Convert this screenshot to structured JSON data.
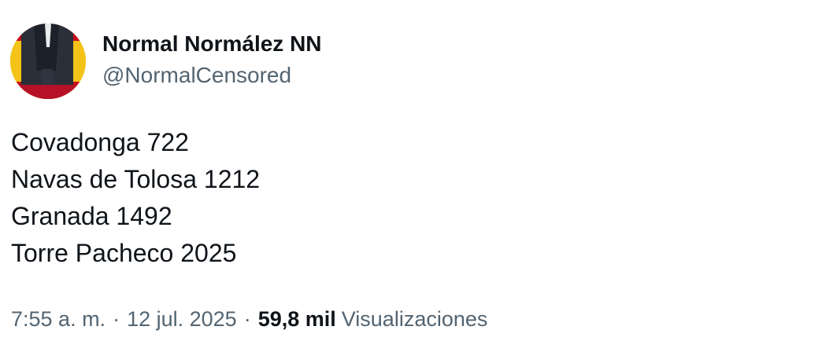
{
  "author": {
    "display_name": "Normal Normález NN",
    "handle": "@NormalCensored",
    "avatar_icon": "profile-avatar-spanish-flag"
  },
  "tweet": {
    "lines": [
      "Covadonga 722",
      "Navas de Tolosa 1212",
      "Granada 1492",
      "Torre Pacheco 2025"
    ]
  },
  "meta": {
    "time": "7:55 a. m.",
    "separator": "·",
    "date": "12 jul. 2025",
    "views_count": "59,8 mil",
    "views_label": "Visualizaciones"
  },
  "colors": {
    "text_primary": "#0f1419",
    "text_secondary": "#536471",
    "flag_red": "#c60b1e",
    "flag_yellow": "#f3c317"
  }
}
